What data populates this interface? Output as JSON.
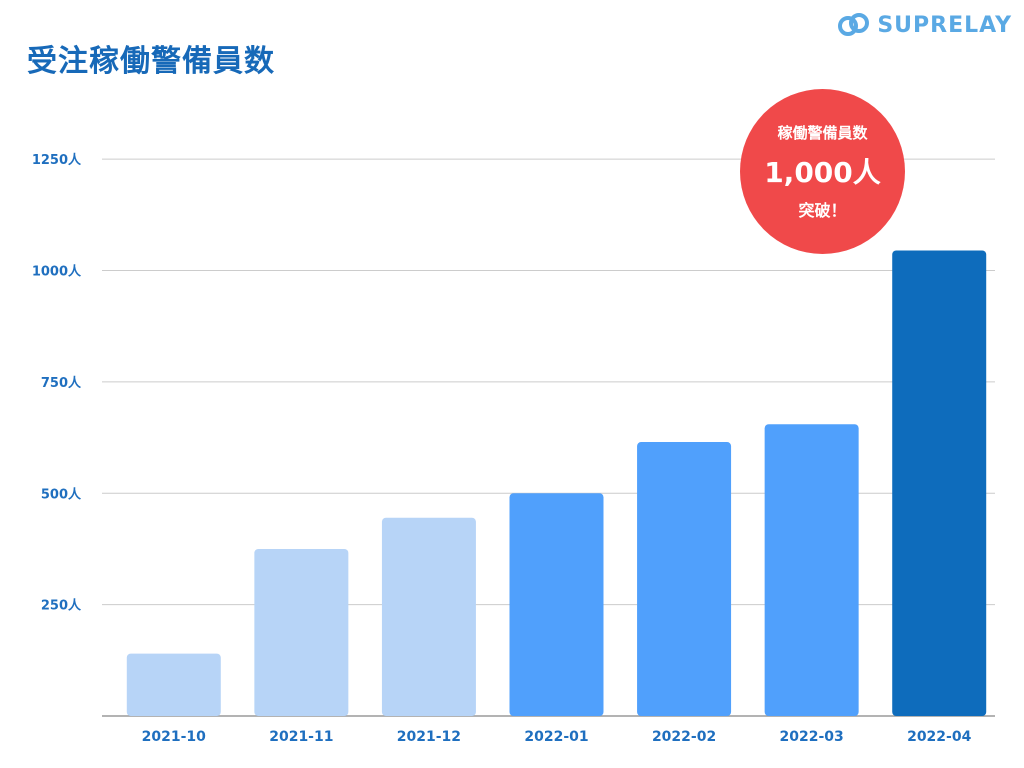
{
  "header": {
    "title": "受注稼働警備員数",
    "logo_text": "SUPRELAY"
  },
  "callout": {
    "line1": "稼働警備員数",
    "line2": "1,000人",
    "line3": "突破！"
  },
  "colors": {
    "title": "#1769b8",
    "logo": "#5aa9e4",
    "callout": "#f0494a",
    "bar_light": "#b7d4f7",
    "bar_mid": "#50a0fc",
    "bar_dark": "#0e6cbc",
    "grid": "#cccccc",
    "tick_text": "#1f6fbf"
  },
  "chart_data": {
    "type": "bar",
    "title": "",
    "xlabel": "",
    "ylabel": "",
    "categories": [
      "2021-10",
      "2021-11",
      "2021-12",
      "2022-01",
      "2022-02",
      "2022-03",
      "2022-04"
    ],
    "values": [
      140,
      375,
      445,
      500,
      615,
      655,
      1045
    ],
    "bar_colors": [
      "#b7d4f7",
      "#b7d4f7",
      "#b7d4f7",
      "#50a0fc",
      "#50a0fc",
      "#50a0fc",
      "#0e6cbc"
    ],
    "ylim": [
      0,
      1300
    ],
    "yticks": [
      250,
      500,
      750,
      1000,
      1250
    ],
    "ytick_labels": [
      "250人",
      "500人",
      "750人",
      "1000人",
      "1250人"
    ],
    "grid": true,
    "legend": "none"
  }
}
